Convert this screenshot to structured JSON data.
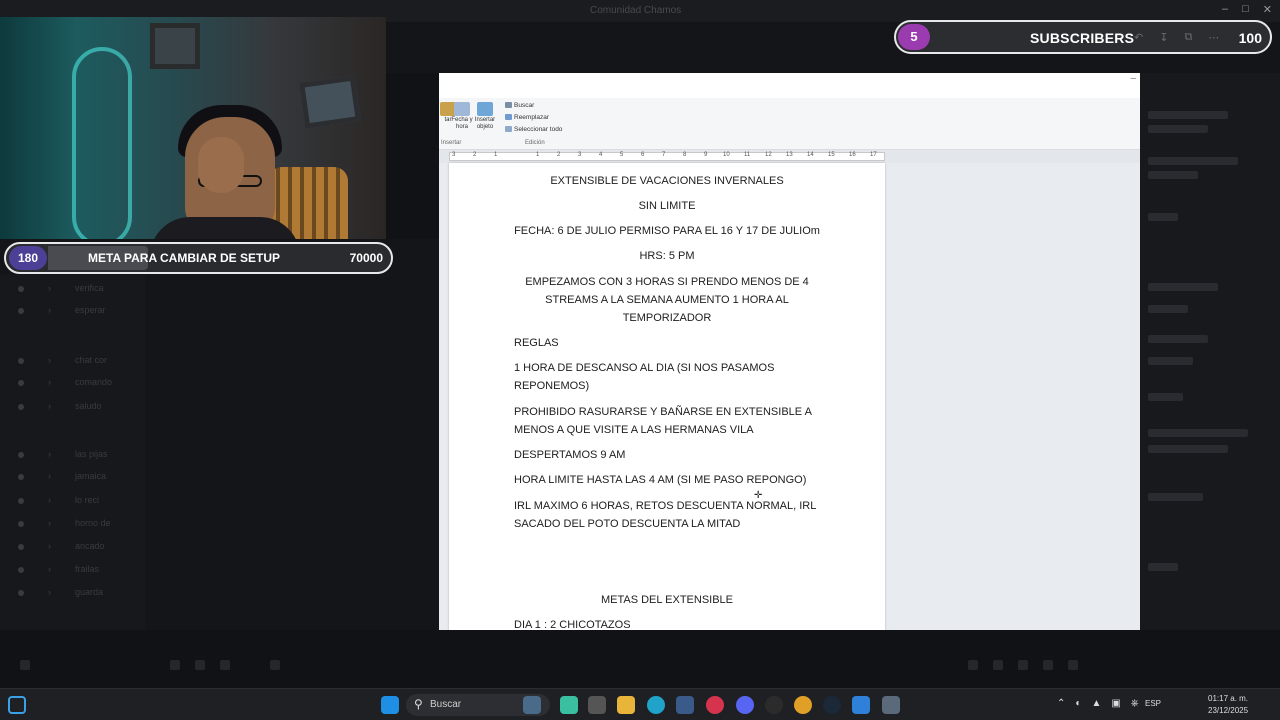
{
  "window": {
    "title": "Comunidad Chamos"
  },
  "overlays": {
    "meta": {
      "badge": "180",
      "label": "META PARA CAMBIAR DE SETUP",
      "goal": "70000"
    },
    "subscribers": {
      "badge": "5",
      "label": "SUBSCRIBERS",
      "goal": "100"
    }
  },
  "ribbon": {
    "buttons": [
      {
        "label": "Fecha y hora"
      },
      {
        "label": "Insertar objeto"
      }
    ],
    "edit_items": [
      "Buscar",
      "Reemplazar",
      "Seleccionar todo"
    ],
    "groups": [
      "Insertar",
      "Edición"
    ]
  },
  "ruler": {
    "numbers": [
      "3",
      "2",
      "1",
      "1",
      "2",
      "3",
      "4",
      "5",
      "6",
      "7",
      "8",
      "9",
      "10",
      "11",
      "12",
      "13",
      "14",
      "15",
      "16",
      "17"
    ]
  },
  "document": {
    "title": "EXTENSIBLE DE VACACIONES INVERNALES",
    "subtitle": "SIN LIMITE",
    "date": "FECHA: 6 DE JULIO PERMISO PARA EL 16 Y 17 DE JULIOm",
    "hours": "HRS: 5 PM",
    "intro_line1": "EMPEZAMOS CON 3 HORAS SI PRENDO MENOS DE 4",
    "intro_line2": "STREAMS A LA SEMANA AUMENTO 1 HORA AL",
    "intro_line3": "TEMPORIZADOR",
    "rules_heading": "REGLAS",
    "rule1_line1": "1 HORA DE DESCANSO AL DIA (SI NOS PASAMOS",
    "rule1_line2": "REPONEMOS)",
    "rule2_line1": "PROHIBIDO RASURARSE Y BAÑARSE EN EXTENSIBLE A",
    "rule2_line2": "MENOS A QUE VISITE A LAS HERMANAS VILA",
    "rule3": "DESPERTAMOS 9 AM",
    "rule4": "HORA LIMITE HASTA LAS 4 AM (SI ME PASO REPONGO)",
    "rule5_line1": "IRL MAXIMO 6 HORAS, RETOS DESCUENTA NORMAL, IRL",
    "rule5_line2": "SACADO DEL POTO DESCUENTA LA MITAD",
    "goals_heading": "METAS DEL EXTENSIBLE",
    "day1": "DIA 1 : 2 CHICOTAZOS"
  },
  "taskbar": {
    "search_placeholder": "Buscar",
    "language": "ESP",
    "time": "01:17 a. m.",
    "date": "23/12/2025"
  }
}
